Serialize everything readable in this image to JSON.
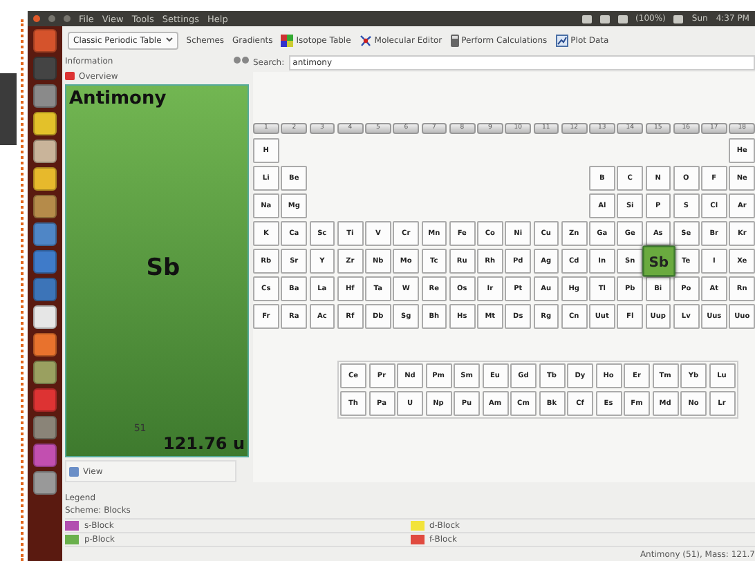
{
  "topbar": {
    "menu": [
      "File",
      "View",
      "Tools",
      "Settings",
      "Help"
    ],
    "battery": "(100%)",
    "day": "Sun",
    "time": "4:37 PM"
  },
  "toolbar": {
    "table_select": "Classic Periodic Table",
    "menus": [
      "Schemes",
      "Gradients"
    ],
    "buttons": [
      {
        "kind": "isotope",
        "label": "Isotope Table"
      },
      {
        "kind": "molecule",
        "label": "Molecular Editor"
      },
      {
        "kind": "calculator",
        "label": "Perform Calculations"
      },
      {
        "kind": "plot",
        "label": "Plot Data"
      }
    ]
  },
  "sidebar": {
    "title": "Information",
    "items": [
      "Overview"
    ],
    "element": {
      "name": "Antimony",
      "number": "51",
      "symbol": "Sb",
      "mass": "121.76 u"
    },
    "view_button": "View"
  },
  "search": {
    "label": "Search:",
    "value": "antimony"
  },
  "table": {
    "groups": [
      "1",
      "2",
      "3",
      "4",
      "5",
      "6",
      "7",
      "8",
      "9",
      "10",
      "11",
      "12",
      "13",
      "14",
      "15",
      "16",
      "17",
      "18"
    ],
    "periods": [
      {
        "left": [
          {
            "symbol": "H",
            "selected": false
          }
        ],
        "right": [
          {
            "symbol": "He",
            "selected": false
          }
        ]
      },
      {
        "left": [
          {
            "symbol": "Li",
            "selected": false
          },
          {
            "symbol": "Be",
            "selected": false
          }
        ],
        "right": [
          {
            "symbol": "B",
            "selected": false
          },
          {
            "symbol": "C",
            "selected": false
          },
          {
            "symbol": "N",
            "selected": false
          },
          {
            "symbol": "O",
            "selected": false
          },
          {
            "symbol": "F",
            "selected": false
          },
          {
            "symbol": "Ne",
            "selected": false
          }
        ]
      },
      {
        "left": [
          {
            "symbol": "Na",
            "selected": false
          },
          {
            "symbol": "Mg",
            "selected": false
          }
        ],
        "right": [
          {
            "symbol": "Al",
            "selected": false
          },
          {
            "symbol": "Si",
            "selected": false
          },
          {
            "symbol": "P",
            "selected": false
          },
          {
            "symbol": "S",
            "selected": false
          },
          {
            "symbol": "Cl",
            "selected": false
          },
          {
            "symbol": "Ar",
            "selected": false
          }
        ]
      },
      {
        "left": [
          {
            "symbol": "K",
            "selected": false
          },
          {
            "symbol": "Ca",
            "selected": false
          },
          {
            "symbol": "Sc",
            "selected": false
          },
          {
            "symbol": "Ti",
            "selected": false
          },
          {
            "symbol": "V",
            "selected": false
          },
          {
            "symbol": "Cr",
            "selected": false
          },
          {
            "symbol": "Mn",
            "selected": false
          },
          {
            "symbol": "Fe",
            "selected": false
          },
          {
            "symbol": "Co",
            "selected": false
          },
          {
            "symbol": "Ni",
            "selected": false
          },
          {
            "symbol": "Cu",
            "selected": false
          },
          {
            "symbol": "Zn",
            "selected": false
          },
          {
            "symbol": "Ga",
            "selected": false
          },
          {
            "symbol": "Ge",
            "selected": false
          },
          {
            "symbol": "As",
            "selected": false
          },
          {
            "symbol": "Se",
            "selected": false
          },
          {
            "symbol": "Br",
            "selected": false
          },
          {
            "symbol": "Kr",
            "selected": false
          }
        ]
      },
      {
        "left": [
          {
            "symbol": "Rb",
            "selected": false
          },
          {
            "symbol": "Sr",
            "selected": false
          },
          {
            "symbol": "Y",
            "selected": false
          },
          {
            "symbol": "Zr",
            "selected": false
          },
          {
            "symbol": "Nb",
            "selected": false
          },
          {
            "symbol": "Mo",
            "selected": false
          },
          {
            "symbol": "Tc",
            "selected": false
          },
          {
            "symbol": "Ru",
            "selected": false
          },
          {
            "symbol": "Rh",
            "selected": false
          },
          {
            "symbol": "Pd",
            "selected": false
          },
          {
            "symbol": "Ag",
            "selected": false
          },
          {
            "symbol": "Cd",
            "selected": false
          },
          {
            "symbol": "In",
            "selected": false
          },
          {
            "symbol": "Sn",
            "selected": false
          },
          {
            "symbol": "Sb",
            "selected": true
          },
          {
            "symbol": "Te",
            "selected": false
          },
          {
            "symbol": "I",
            "selected": false
          },
          {
            "symbol": "Xe",
            "selected": false
          }
        ]
      },
      {
        "left": [
          {
            "symbol": "Cs",
            "selected": false
          },
          {
            "symbol": "Ba",
            "selected": false
          },
          {
            "symbol": "La",
            "selected": false
          },
          {
            "symbol": "Hf",
            "selected": false
          },
          {
            "symbol": "Ta",
            "selected": false
          },
          {
            "symbol": "W",
            "selected": false
          },
          {
            "symbol": "Re",
            "selected": false
          },
          {
            "symbol": "Os",
            "selected": false
          },
          {
            "symbol": "Ir",
            "selected": false
          },
          {
            "symbol": "Pt",
            "selected": false
          },
          {
            "symbol": "Au",
            "selected": false
          },
          {
            "symbol": "Hg",
            "selected": false
          },
          {
            "symbol": "Tl",
            "selected": false
          },
          {
            "symbol": "Pb",
            "selected": false
          },
          {
            "symbol": "Bi",
            "selected": false
          },
          {
            "symbol": "Po",
            "selected": false
          },
          {
            "symbol": "At",
            "selected": false
          },
          {
            "symbol": "Rn",
            "selected": false
          }
        ]
      },
      {
        "left": [
          {
            "symbol": "Fr",
            "selected": false
          },
          {
            "symbol": "Ra",
            "selected": false
          },
          {
            "symbol": "Ac",
            "selected": false
          },
          {
            "symbol": "Rf",
            "selected": false
          },
          {
            "symbol": "Db",
            "selected": false
          },
          {
            "symbol": "Sg",
            "selected": false
          },
          {
            "symbol": "Bh",
            "selected": false
          },
          {
            "symbol": "Hs",
            "selected": false
          },
          {
            "symbol": "Mt",
            "selected": false
          },
          {
            "symbol": "Ds",
            "selected": false
          },
          {
            "symbol": "Rg",
            "selected": false
          },
          {
            "symbol": "Cn",
            "selected": false
          },
          {
            "symbol": "Uut",
            "selected": false
          },
          {
            "symbol": "Fl",
            "selected": false
          },
          {
            "symbol": "Uup",
            "selected": false
          },
          {
            "symbol": "Lv",
            "selected": false
          },
          {
            "symbol": "Uus",
            "selected": false
          },
          {
            "symbol": "Uuo",
            "selected": false
          }
        ]
      }
    ],
    "lanthanides": [
      {
        "symbol": "Ce",
        "selected": false
      },
      {
        "symbol": "Pr",
        "selected": false
      },
      {
        "symbol": "Nd",
        "selected": false
      },
      {
        "symbol": "Pm",
        "selected": false
      },
      {
        "symbol": "Sm",
        "selected": false
      },
      {
        "symbol": "Eu",
        "selected": false
      },
      {
        "symbol": "Gd",
        "selected": false
      },
      {
        "symbol": "Tb",
        "selected": false
      },
      {
        "symbol": "Dy",
        "selected": false
      },
      {
        "symbol": "Ho",
        "selected": false
      },
      {
        "symbol": "Er",
        "selected": false
      },
      {
        "symbol": "Tm",
        "selected": false
      },
      {
        "symbol": "Yb",
        "selected": false
      },
      {
        "symbol": "Lu",
        "selected": false
      }
    ],
    "actinides": [
      {
        "symbol": "Th",
        "selected": false
      },
      {
        "symbol": "Pa",
        "selected": false
      },
      {
        "symbol": "U",
        "selected": false
      },
      {
        "symbol": "Np",
        "selected": false
      },
      {
        "symbol": "Pu",
        "selected": false
      },
      {
        "symbol": "Am",
        "selected": false
      },
      {
        "symbol": "Cm",
        "selected": false
      },
      {
        "symbol": "Bk",
        "selected": false
      },
      {
        "symbol": "Cf",
        "selected": false
      },
      {
        "symbol": "Es",
        "selected": false
      },
      {
        "symbol": "Fm",
        "selected": false
      },
      {
        "symbol": "Md",
        "selected": false
      },
      {
        "symbol": "No",
        "selected": false
      },
      {
        "symbol": "Lr",
        "selected": false
      }
    ]
  },
  "legend": {
    "title": "Legend",
    "scheme": "Scheme: Blocks",
    "items": [
      {
        "label": "s-Block",
        "color": "#b24fb0"
      },
      {
        "label": "d-Block",
        "color": "#f2e33a"
      },
      {
        "label": "p-Block",
        "color": "#6ab04c"
      },
      {
        "label": "f-Block",
        "color": "#e04a3f"
      }
    ]
  },
  "status_bar": "Antimony (51), Mass: 121.7"
}
